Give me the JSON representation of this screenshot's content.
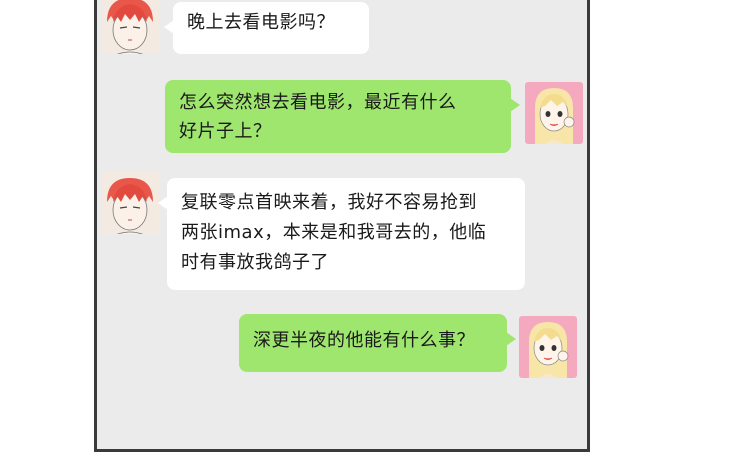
{
  "conversation": {
    "messages": [
      {
        "sender": "boy",
        "lines": [
          "晚上去看电影吗？"
        ]
      },
      {
        "sender": "girl",
        "lines": [
          "怎么突然想去看电影，最近有什么",
          "好片子上？"
        ]
      },
      {
        "sender": "boy",
        "lines": [
          "复联零点首映来着，我好不容易抢到",
          "两张imax，本来是和我哥去的，他临",
          "时有事放我鸽子了"
        ]
      },
      {
        "sender": "girl",
        "lines": [
          "深更半夜的他能有什么事？"
        ]
      }
    ]
  },
  "colors": {
    "incoming_bubble": "#ffffff",
    "outgoing_bubble": "#9fe66e",
    "chat_background": "#ebebeb",
    "panel_border": "#3a3a3a"
  },
  "icons": {
    "boy_avatar": "red-haired-boy-avatar-icon",
    "girl_avatar": "blonde-girl-avatar-icon"
  }
}
